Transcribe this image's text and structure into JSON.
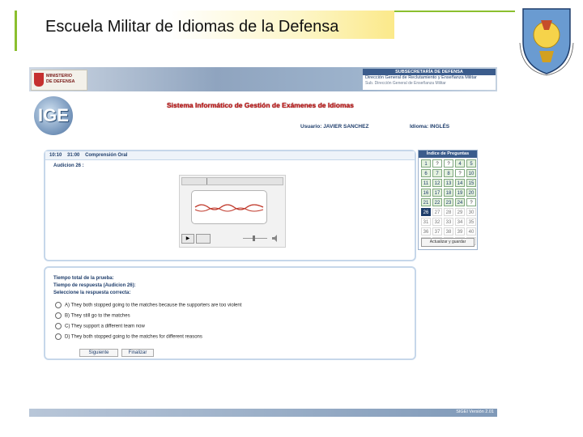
{
  "slide": {
    "title": "Escuela Militar de Idiomas de la Defensa"
  },
  "header": {
    "ministry": [
      "MINISTERIO",
      "DE DEFENSA"
    ],
    "subsecretaria": "SUBSECRETARÍA DE DEFENSA",
    "direccion": "Dirección General de Reclutamiento y Enseñanza Militar",
    "subdireccion": "Sub. Dirección General de Enseñanza Militar"
  },
  "app": {
    "logo_text": "IGE",
    "system_name": "Sistema Informático de Gestión de Exámenes de Idiomas",
    "user_label": "Usuario:",
    "user_value": "JAVIER SANCHEZ",
    "language_label": "Idioma:",
    "language_value": "INGLÉS"
  },
  "question_panel": {
    "time_elapsed": "10:10",
    "time_total": "31:00",
    "section": "Comprensión Oral",
    "audio_label": "Audicion 26 :"
  },
  "question_index": {
    "title": "Índice de Preguntas",
    "save_label": "Actualizar y guardar",
    "cells": [
      {
        "label": "1",
        "state": "done"
      },
      {
        "label": "?",
        "state": "pending"
      },
      {
        "label": "?",
        "state": "pending"
      },
      {
        "label": "4",
        "state": "done"
      },
      {
        "label": "5",
        "state": "done"
      },
      {
        "label": "6",
        "state": "done"
      },
      {
        "label": "7",
        "state": "done"
      },
      {
        "label": "8",
        "state": "done"
      },
      {
        "label": "?",
        "state": "pending"
      },
      {
        "label": "10",
        "state": "done"
      },
      {
        "label": "11",
        "state": "done"
      },
      {
        "label": "12",
        "state": "done"
      },
      {
        "label": "13",
        "state": "done"
      },
      {
        "label": "14",
        "state": "done"
      },
      {
        "label": "15",
        "state": "done"
      },
      {
        "label": "16",
        "state": "done"
      },
      {
        "label": "17",
        "state": "done"
      },
      {
        "label": "18",
        "state": "done"
      },
      {
        "label": "19",
        "state": "done"
      },
      {
        "label": "20",
        "state": "done"
      },
      {
        "label": "21",
        "state": "done"
      },
      {
        "label": "22",
        "state": "done"
      },
      {
        "label": "23",
        "state": "done"
      },
      {
        "label": "24",
        "state": "done"
      },
      {
        "label": "?",
        "state": "pending"
      },
      {
        "label": "26",
        "state": "current"
      },
      {
        "label": "27",
        "state": "none"
      },
      {
        "label": "28",
        "state": "none"
      },
      {
        "label": "29",
        "state": "none"
      },
      {
        "label": "30",
        "state": "none"
      },
      {
        "label": "31",
        "state": "none"
      },
      {
        "label": "32",
        "state": "none"
      },
      {
        "label": "33",
        "state": "none"
      },
      {
        "label": "34",
        "state": "none"
      },
      {
        "label": "35",
        "state": "none"
      },
      {
        "label": "36",
        "state": "none"
      },
      {
        "label": "37",
        "state": "none"
      },
      {
        "label": "38",
        "state": "none"
      },
      {
        "label": "39",
        "state": "none"
      },
      {
        "label": "40",
        "state": "none"
      },
      {
        "label": "41",
        "state": "none"
      },
      {
        "label": "42",
        "state": "none"
      },
      {
        "label": "43",
        "state": "none"
      },
      {
        "label": "44",
        "state": "none"
      },
      {
        "label": "45",
        "state": "none"
      }
    ]
  },
  "answer_panel": {
    "total_time_label": "Tiempo total de la prueba:",
    "answer_time_label": "Tiempo de respuesta (Audicion 26):",
    "select_label": "Seleccione la respuesta correcta:",
    "options": [
      "A) They both stopped going to the matches because the supporters are too violent",
      "B) They still go to the matches",
      "C) They support a different team now",
      "D) They both stopped going to the matches for different reasons"
    ],
    "next_label": "Siguiente",
    "finish_label": "Finalizar"
  },
  "footer": {
    "version": "SIGEI Versión 2.01"
  }
}
